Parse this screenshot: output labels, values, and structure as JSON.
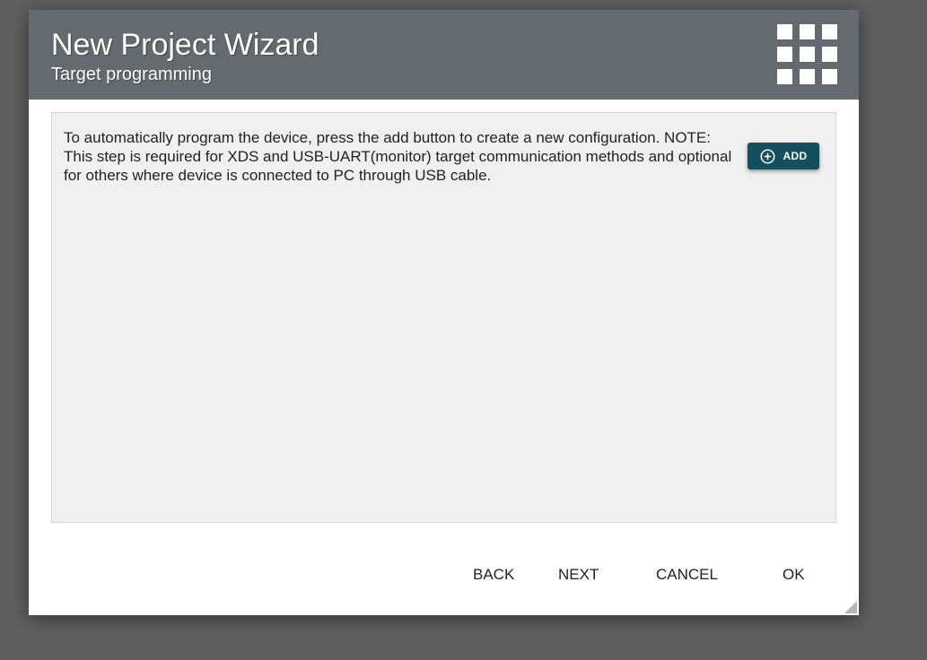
{
  "dialog": {
    "title": "New Project Wizard",
    "subtitle": "Target programming",
    "header_icon": "grid-icon",
    "colors": {
      "header_bg": "#646a70",
      "accent": "#134f5c",
      "panel_bg": "#f0f0f0"
    }
  },
  "panel": {
    "message": "To automatically program the device, press the add button to create a new configuration. NOTE: This step is required for XDS and USB-UART(monitor) target communication methods and optional for others where device is connected to PC through USB cable.",
    "add_button": {
      "label": "ADD",
      "icon": "plus-circle-icon"
    }
  },
  "footer": {
    "back_label": "BACK",
    "next_label": "NEXT",
    "cancel_label": "CANCEL",
    "ok_label": "OK"
  }
}
